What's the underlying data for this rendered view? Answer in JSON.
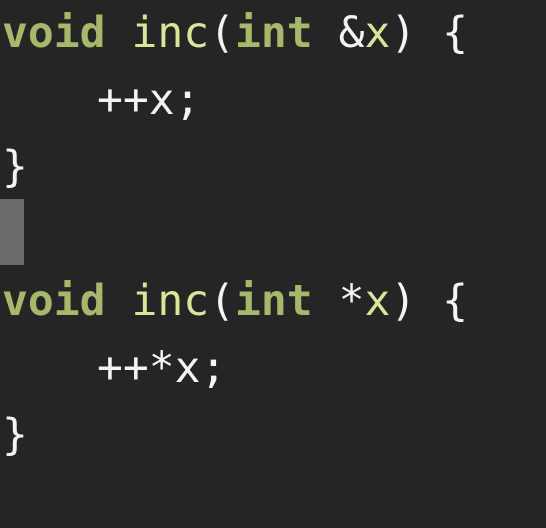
{
  "editor": {
    "lines": [
      {
        "kw1": "void",
        "fn": "inc",
        "paren_open": "(",
        "kw2": "int",
        "op": " &",
        "param": "x",
        "rest": ") {"
      },
      {
        "code": "++x;"
      },
      {
        "code": "}"
      },
      {
        "code": ""
      },
      {
        "kw1": "void",
        "fn": "inc",
        "paren_open": "(",
        "kw2": "int",
        "op": " *",
        "param": "x",
        "rest": ") {"
      },
      {
        "code": "++*x;"
      },
      {
        "code": "}"
      }
    ],
    "colors": {
      "background": "#252525",
      "keyword": "#a6b86b",
      "function": "#d8e69b",
      "identifier": "#d8e69b",
      "text": "#f4f4f4",
      "cursor": "#6b6b6b"
    }
  }
}
